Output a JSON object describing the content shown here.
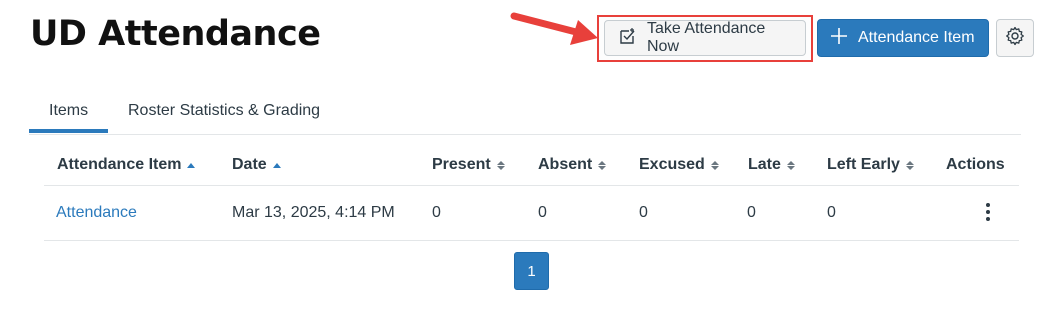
{
  "header": {
    "title": "UD Attendance",
    "take_attendance_label": "Take Attendance Now",
    "add_item_label": "Attendance Item",
    "take_icon": "checklist-icon",
    "add_icon": "plus-icon",
    "settings_icon": "gear-icon",
    "colors": {
      "primary": "#2b7abc",
      "highlight": "#e8403b"
    }
  },
  "tabs": [
    {
      "label": "Items",
      "active": true
    },
    {
      "label": "Roster Statistics & Grading",
      "active": false
    }
  ],
  "table": {
    "columns": [
      "Attendance Item",
      "Date",
      "Present",
      "Absent",
      "Excused",
      "Late",
      "Left Early",
      "Actions"
    ],
    "rows": [
      {
        "item": "Attendance",
        "date": "Mar 13, 2025, 4:14 PM",
        "present": "0",
        "absent": "0",
        "excused": "0",
        "late": "0",
        "left_early": "0"
      }
    ]
  },
  "pagination": {
    "current": "1"
  }
}
